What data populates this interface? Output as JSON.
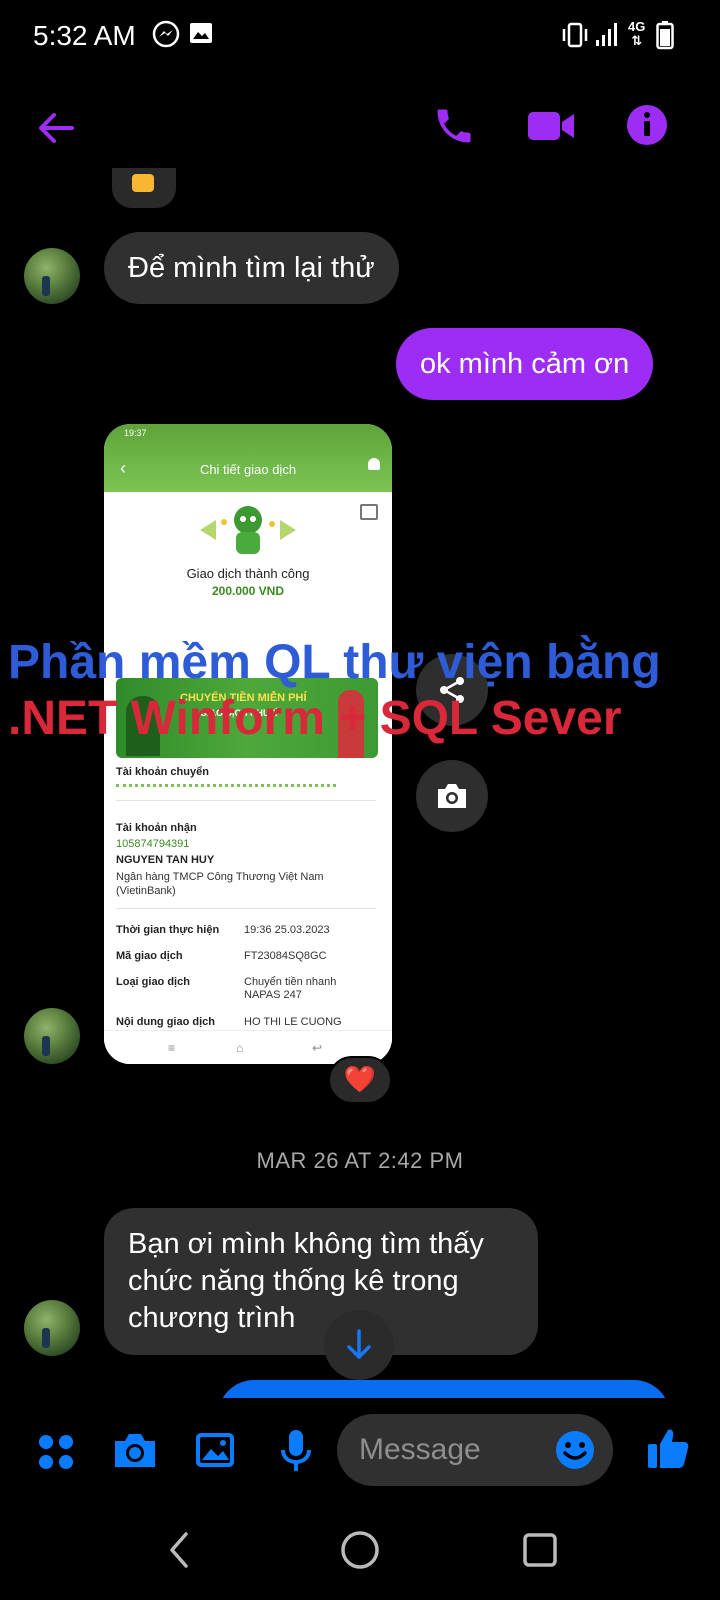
{
  "status_bar": {
    "time": "5:32 AM",
    "network": "4G"
  },
  "header": {
    "back_icon": "arrow-left-icon",
    "actions": [
      "phone-icon",
      "video-icon",
      "info-icon"
    ],
    "accent_color": "#9d2df5"
  },
  "messages": [
    {
      "from": "other",
      "text": "Để mình tìm lại thử"
    },
    {
      "from": "me",
      "text": "ok mình cảm ơn"
    },
    {
      "from": "other",
      "text": "Bạn ơi mình không tìm thấy chức năng thống kê trong chương trình"
    }
  ],
  "timestamp": "MAR 26 AT 2:42 PM",
  "receipt": {
    "status_time": "19:37",
    "title": "Chi tiết giao dịch",
    "result": "Giao dịch thành công",
    "amount": "200.000 VND",
    "banner_title": "CHUYỂN TIỀN MIỄN PHÍ",
    "banner_sub": "GIAO DỊCH NHƯ Ý",
    "source_label": "Tài khoản chuyển",
    "recv_label": "Tài khoản nhận",
    "recv_account": "105874794391",
    "recv_name": "NGUYEN TAN HUY",
    "recv_bank": "Ngân hàng TMCP Công Thương Việt Nam (VietinBank)",
    "rows": [
      {
        "label": "Thời gian thực hiện",
        "value": "19:36 25.03.2023"
      },
      {
        "label": "Mã giao dịch",
        "value": "FT23084SQ8GC"
      },
      {
        "label": "Loại giao dịch",
        "value": "Chuyển tiền nhanh NAPAS 247"
      },
      {
        "label": "Nội dung giao dịch",
        "value": "HO THI LE CUONG chuyen tien"
      }
    ]
  },
  "watermark": {
    "line1": "Phần mềm QL  thư viện bằng",
    "line2": ".NET Winform + SQL Sever"
  },
  "reaction": "❤️",
  "composer": {
    "placeholder": "Message",
    "icons": [
      "apps-icon",
      "camera-icon",
      "gallery-icon",
      "mic-icon",
      "emoji-icon",
      "like-icon"
    ],
    "accent_color": "#0a7cff"
  }
}
